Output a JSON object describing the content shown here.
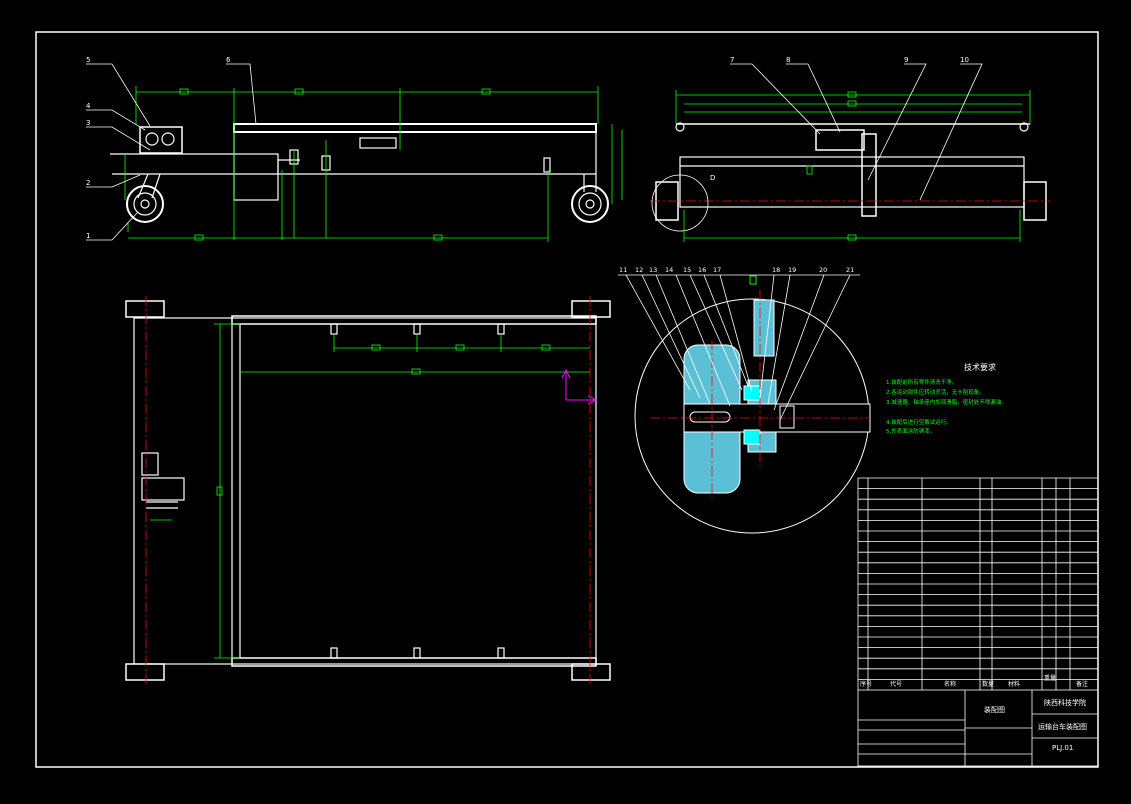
{
  "balloons_top_left": [
    "5",
    "6",
    "4",
    "3",
    "2",
    "1"
  ],
  "balloons_top_right": [
    "7",
    "8",
    "9",
    "10"
  ],
  "detail_view_label": "D",
  "balloons_detail": [
    "11",
    "12",
    "13",
    "14",
    "15",
    "16",
    "17",
    "18",
    "19",
    "20",
    "21"
  ],
  "tech_requirements": {
    "title": "技术要求",
    "lines": [
      "1.装配前所有零件清洗干净。",
      "2.各运动部件应转动灵活，无卡阻现象。",
      "3.减速器、轴承座内加润滑脂，密封处不得漏油。",
      "4.装配后进行空载试运行。",
      "5.外表面涂防锈漆。"
    ]
  },
  "bom_headers": {
    "seq": "序号",
    "code": "代号",
    "name": "名称",
    "qty": "数量",
    "material": "材料",
    "weight": "重量",
    "remark": "备注"
  },
  "title_block": {
    "school": "陕西科技学院",
    "drawing_type": "装配图",
    "drawing_name": "运输台车装配图",
    "drawing_no": "PLJ.01"
  }
}
